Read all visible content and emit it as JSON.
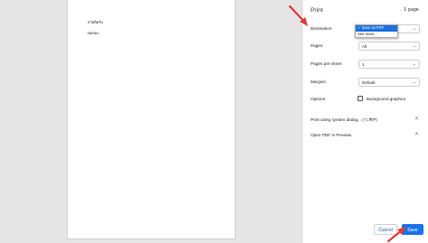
{
  "preview": {
    "line1": "สวัสดีครับ",
    "line2": "ทดสอบ"
  },
  "panel": {
    "title": "Print",
    "page_count": "1 page",
    "destination_label": "Destination",
    "destination_options": [
      "✓ Save as PDF",
      "See more..."
    ],
    "pages_label": "Pages",
    "pages_value": "All",
    "pages_per_sheet_label": "Pages per sheet",
    "pages_per_sheet_value": "1",
    "margins_label": "Margins",
    "margins_value": "Default",
    "options_label": "Options",
    "background_graphics_label": "Background graphics",
    "system_dialog_label": "Print using system dialog... (⌥⌘P)",
    "open_pdf_label": "Open PDF in Preview",
    "cancel_label": "Cancel",
    "save_label": "Save"
  },
  "colors": {
    "accent": "#1a73e8",
    "annotation_arrow": "#e53935"
  }
}
